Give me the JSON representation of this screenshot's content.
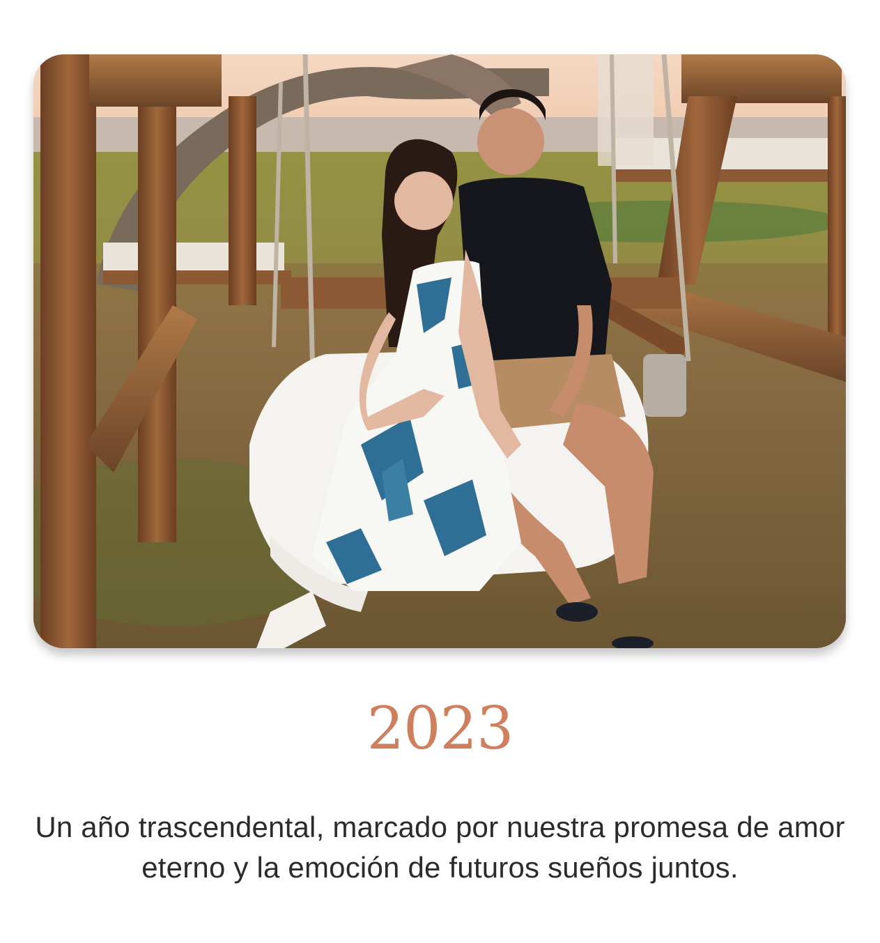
{
  "photo": {
    "icon": "couple-photo-image",
    "accent_color": "#cf7f5e"
  },
  "year": "2023",
  "caption": "Un año trascendental, marcado por nuestra promesa de amor eterno y la emoción de futuros sueños juntos."
}
